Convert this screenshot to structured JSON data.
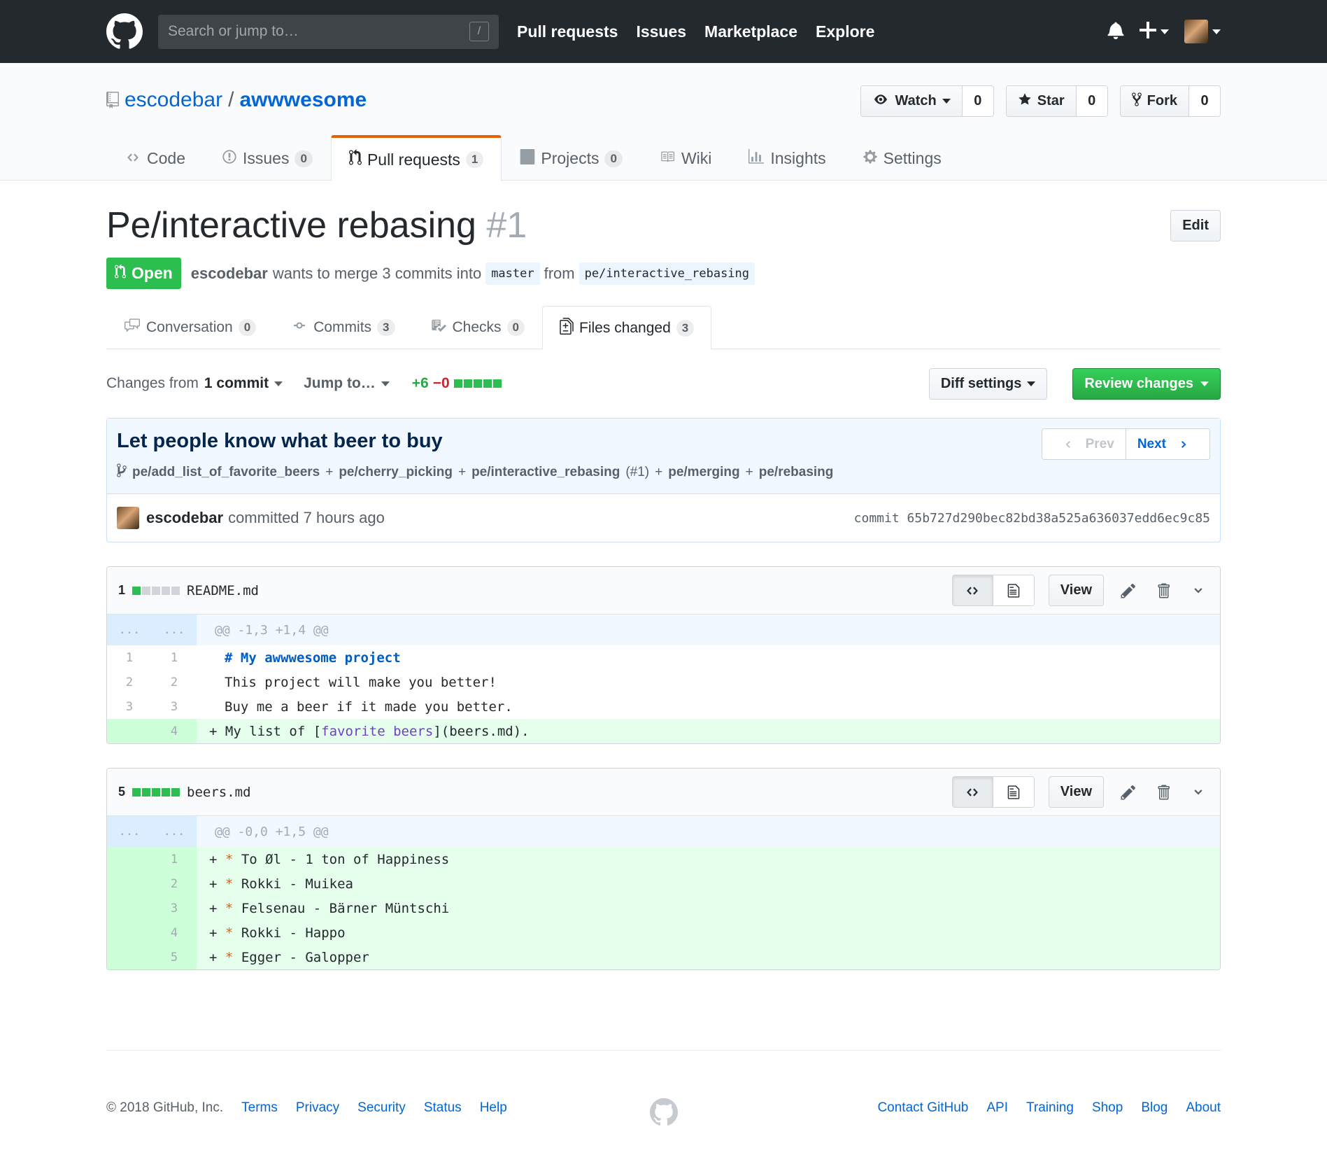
{
  "header": {
    "search_placeholder": "Search or jump to…",
    "search_shortcut": "/",
    "nav": [
      "Pull requests",
      "Issues",
      "Marketplace",
      "Explore"
    ],
    "icons": {
      "logo": "github-octocat-icon",
      "notifications": "bell-icon",
      "create": "plus-icon"
    }
  },
  "repo": {
    "owner": "escodebar",
    "separator": "/",
    "name": "awwwesome",
    "watch": {
      "label": "Watch",
      "count": "0"
    },
    "star": {
      "label": "Star",
      "count": "0"
    },
    "fork": {
      "label": "Fork",
      "count": "0"
    },
    "tabs": [
      {
        "label": "Code"
      },
      {
        "label": "Issues",
        "count": "0"
      },
      {
        "label": "Pull requests",
        "count": "1"
      },
      {
        "label": "Projects",
        "count": "0"
      },
      {
        "label": "Wiki"
      },
      {
        "label": "Insights"
      },
      {
        "label": "Settings"
      }
    ],
    "accent_color": "#e36209"
  },
  "pr": {
    "title": "Pe/interactive rebasing",
    "number": "#1",
    "edit_label": "Edit",
    "state": "Open",
    "state_color": "#2cbe4e",
    "author": "escodebar",
    "merge_text": "wants to merge 3 commits into",
    "base": "master",
    "from": "from",
    "head": "pe/interactive_rebasing",
    "tabs": [
      {
        "label": "Conversation",
        "count": "0"
      },
      {
        "label": "Commits",
        "count": "3"
      },
      {
        "label": "Checks",
        "count": "0"
      },
      {
        "label": "Files changed",
        "count": "3"
      }
    ]
  },
  "toolbar": {
    "changes_prefix": "Changes from",
    "changes_bold": "1 commit",
    "jump": "Jump to…",
    "additions": "+6",
    "deletions": "−0",
    "diff_settings": "Diff settings",
    "review": "Review changes"
  },
  "commit": {
    "title": "Let people know what beer to buy",
    "branches": [
      "pe/add_list_of_favorite_beers",
      "pe/cherry_picking",
      "pe/interactive_rebasing",
      "pe/merging",
      "pe/rebasing"
    ],
    "pr_ref": "(#1)",
    "plus": "+",
    "prev": "Prev",
    "next": "Next",
    "author": "escodebar",
    "action": "committed 7 hours ago",
    "sha": "commit 65b727d290bec82bd38a525a636037edd6ec9c85"
  },
  "files": [
    {
      "count": "1",
      "name": "README.md",
      "view_label": "View",
      "hunk": "@@ -1,3 +1,4 @@",
      "lines": [
        {
          "old": "1",
          "new": "1",
          "type": "ctx"
        },
        {
          "old": "2",
          "new": "2",
          "type": "ctx",
          "text": "This project will make you better!"
        },
        {
          "old": "3",
          "new": "3",
          "type": "ctx",
          "text": "Buy me a beer if it made you better."
        },
        {
          "old": "",
          "new": "4",
          "type": "add"
        }
      ],
      "line1_kw": "# My awwwesome project",
      "line4_pre": "+ My list of [",
      "line4_link": "favorite beers",
      "line4_post": "](beers.md)."
    },
    {
      "count": "5",
      "name": "beers.md",
      "view_label": "View",
      "hunk": "@@ -0,0 +1,5 @@",
      "lines": [
        {
          "new": "1",
          "text": "To Øl - 1 ton of Happiness"
        },
        {
          "new": "2",
          "text": "Rokki - Muikea"
        },
        {
          "new": "3",
          "text": "Felsenau - Bärner Müntschi"
        },
        {
          "new": "4",
          "text": "Rokki - Happo"
        },
        {
          "new": "5",
          "text": "Egger - Galopper"
        }
      ],
      "plus": "+",
      "bullet": "*"
    }
  ],
  "hunk_dots": "...",
  "footer": {
    "copyright": "© 2018 GitHub, Inc.",
    "left_links": [
      "Terms",
      "Privacy",
      "Security",
      "Status",
      "Help"
    ],
    "right_links": [
      "Contact GitHub",
      "API",
      "Training",
      "Shop",
      "Blog",
      "About"
    ]
  }
}
